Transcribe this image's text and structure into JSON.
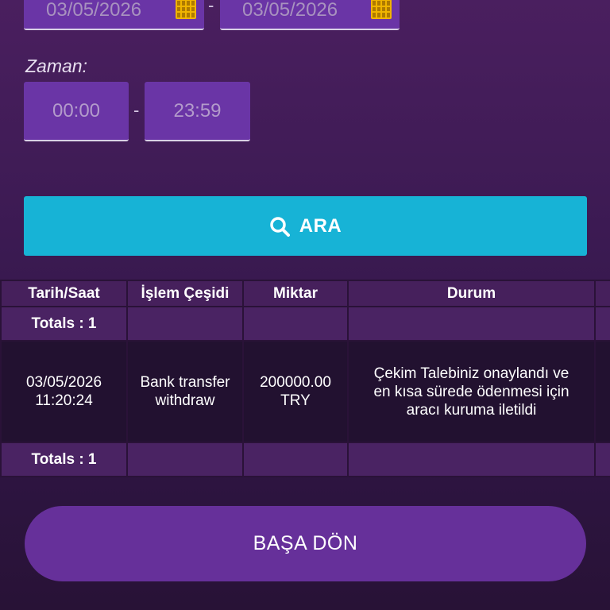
{
  "filters": {
    "date_from": "03/05/2026",
    "date_to": "03/05/2026",
    "date_separator": "-",
    "time_label": "Zaman:",
    "time_from": "00:00",
    "time_to": "23:59",
    "time_separator": "-",
    "icon": "calendar-icon",
    "accent_color": "#6a35a6"
  },
  "search_button": {
    "label": "ARA",
    "icon": "search-icon",
    "color": "#17b3d6"
  },
  "table": {
    "columns": [
      "Tarih/Saat",
      "İşlem Çeşidi",
      "Miktar",
      "Durum",
      ""
    ],
    "totals_label": "Totals : 1",
    "rows": [
      {
        "date": "03/05/2026",
        "time": "11:20:24",
        "type_line1": "Bank transfer",
        "type_line2": "withdraw",
        "amount": "200000.00",
        "currency": "TRY",
        "status_line1": "Çekim Talebiniz onaylandı ve",
        "status_line2": "en kısa sürede ödenmesi için",
        "status_line3": "aracı kuruma iletildi"
      }
    ]
  },
  "back_button": {
    "label": "BAŞA DÖN",
    "color": "#66309a"
  }
}
